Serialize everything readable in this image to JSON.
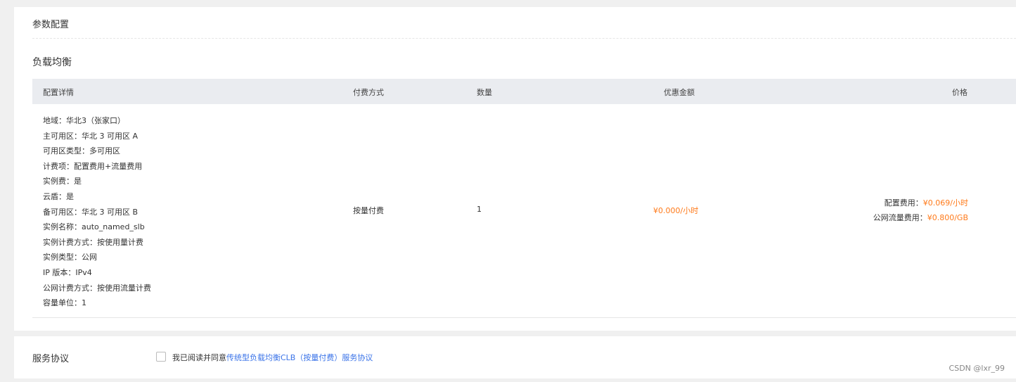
{
  "section": {
    "title": "参数配置"
  },
  "lb": {
    "title": "负载均衡",
    "table": {
      "headers": {
        "detail": "配置详情",
        "payment": "付费方式",
        "quantity": "数量",
        "discount": "优惠金额",
        "price": "价格"
      },
      "details": [
        "地域：华北3（张家口）",
        "主可用区：华北 3 可用区 A",
        "可用区类型：多可用区",
        "计费项：配置费用+流量费用",
        "实例费：是",
        "云盾：是",
        "备可用区：华北 3 可用区 B",
        "实例名称：auto_named_slb",
        "实例计费方式：按使用量计费",
        "实例类型：公网",
        "IP 版本：IPv4",
        "公网计费方式：按使用流量计费",
        "容量单位：1"
      ],
      "payment": "按量付费",
      "quantity": "1",
      "discount": "¥0.000/小时",
      "price": {
        "config_label": "配置费用：",
        "config_value": "¥0.069/小时",
        "traffic_label": "公网流量费用：",
        "traffic_value": "¥0.800/GB"
      }
    }
  },
  "agreement": {
    "title": "服务协议",
    "text": "我已阅读并同意",
    "link": "传统型负载均衡CLB（按量付费）服务协议"
  },
  "watermark": "CSDN @lxr_99",
  "colors": {
    "accent": "#ff7a1a",
    "link": "#3a73e8",
    "header_bg": "#eaecf0"
  }
}
